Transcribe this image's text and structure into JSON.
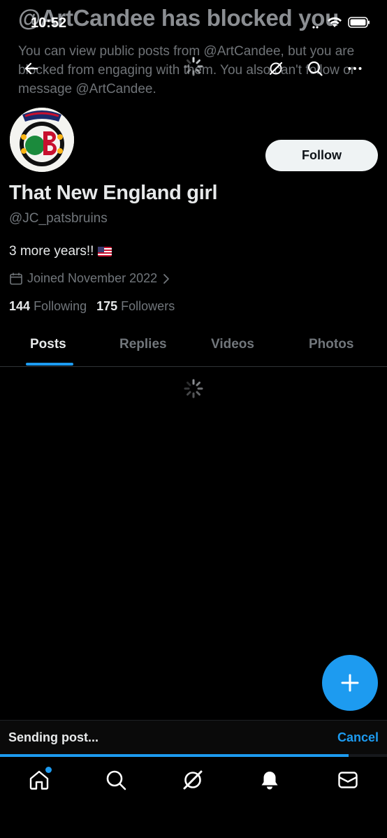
{
  "status_bar": {
    "time": "10:52"
  },
  "blocked_banner": {
    "title": "@ArtCandee has blocked you",
    "description": "You can view public posts from @ArtCandee, but you are blocked from engaging with them. You also can't follow or message @ArtCandee."
  },
  "header": {
    "back_icon": "arrow-left-icon",
    "grok_icon": "grok-icon",
    "search_icon": "search-icon",
    "more_icon": "more-icon"
  },
  "profile": {
    "display_name": "That New England girl",
    "handle": "@JC_patsbruins",
    "bio": "3 more years!!",
    "joined": "Joined November 2022",
    "following_count": "144",
    "following_label": "Following",
    "followers_count": "175",
    "followers_label": "Followers",
    "follow_label": "Follow"
  },
  "tabs": [
    {
      "label": "Posts",
      "active": true
    },
    {
      "label": "Replies",
      "active": false
    },
    {
      "label": "Videos",
      "active": false
    },
    {
      "label": "Photos",
      "active": false
    }
  ],
  "sending": {
    "label": "Sending post...",
    "cancel_label": "Cancel",
    "progress": 0.9
  },
  "bottom_nav": [
    {
      "name": "home",
      "icon": "home-icon",
      "has_badge": true
    },
    {
      "name": "search",
      "icon": "search-icon",
      "has_badge": false
    },
    {
      "name": "grok",
      "icon": "grok-icon",
      "has_badge": false
    },
    {
      "name": "notifications",
      "icon": "bell-icon",
      "has_badge": false
    },
    {
      "name": "messages",
      "icon": "mail-icon",
      "has_badge": false
    }
  ],
  "colors": {
    "accent": "#1d9bf0",
    "background": "#000000",
    "text_primary": "#e7e9ea",
    "text_secondary": "#71767b"
  }
}
